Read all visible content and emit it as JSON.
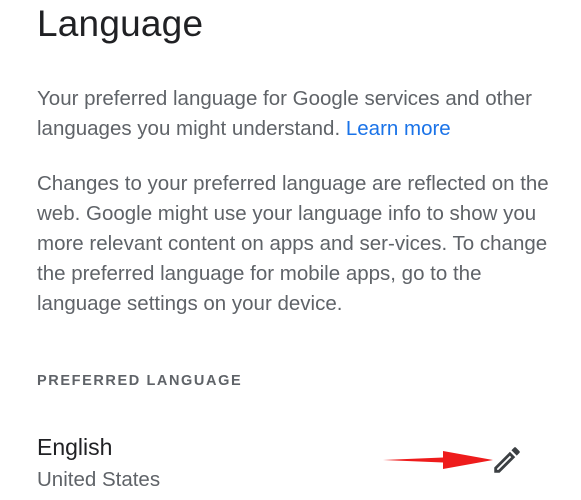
{
  "header": {
    "title": "Language"
  },
  "intro": {
    "text": "Your preferred language for Google services and other languages you might understand. ",
    "learn_more": "Learn more"
  },
  "description": {
    "text": "Changes to your preferred language are reflected on the web. Google might use your language info to show you more relevant content on apps and ser-vices. To change the preferred language for mobile apps, go to the language settings on your device."
  },
  "preferred": {
    "section_label": "PREFERRED LANGUAGE",
    "language": "English",
    "region": "United States"
  },
  "icons": {
    "edit": "pencil-icon",
    "annotation": "arrow-right-icon"
  },
  "colors": {
    "link": "#1a73e8",
    "annotation_arrow": "#ee1c1c",
    "secondary_text": "#5f6368"
  }
}
